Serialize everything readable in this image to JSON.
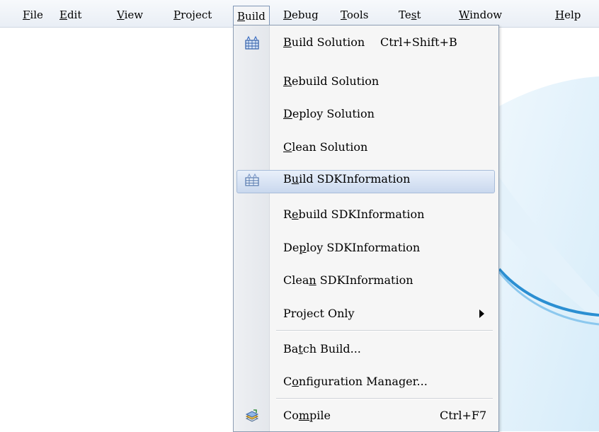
{
  "menubar": {
    "items": [
      {
        "label": "File",
        "hotkey": "F"
      },
      {
        "label": "Edit",
        "hotkey": "E"
      },
      {
        "label": "View",
        "hotkey": "V"
      },
      {
        "label": "Project",
        "hotkey": "P"
      },
      {
        "label": "Build",
        "hotkey": "B"
      },
      {
        "label": "Debug",
        "hotkey": "D"
      },
      {
        "label": "Tools",
        "hotkey": "T"
      },
      {
        "label": "Test",
        "hotkey": "s"
      },
      {
        "label": "Window",
        "hotkey": "W"
      },
      {
        "label": "Help",
        "hotkey": "H"
      }
    ],
    "active": "Build"
  },
  "build_menu": {
    "items": [
      {
        "pre": "",
        "key": "B",
        "post": "uild Solution",
        "shortcut": "Ctrl+Shift+B",
        "icon": "build-solution-icon"
      },
      {
        "pre": "",
        "key": "R",
        "post": "ebuild Solution"
      },
      {
        "pre": "",
        "key": "D",
        "post": "eploy Solution"
      },
      {
        "pre": "",
        "key": "C",
        "post": "lean Solution"
      },
      {
        "pre": "B",
        "key": "u",
        "post": "ild SDKInformation",
        "icon": "build-project-icon",
        "highlighted": true
      },
      {
        "pre": "R",
        "key": "e",
        "post": "build SDKInformation"
      },
      {
        "pre": "De",
        "key": "p",
        "post": "loy SDKInformation"
      },
      {
        "pre": "Clea",
        "key": "n",
        "post": " SDKInformation"
      },
      {
        "pre": "Pro",
        "key": "j",
        "post": "ect Only",
        "submenu": true
      },
      {
        "pre": "Ba",
        "key": "t",
        "post": "ch Build..."
      },
      {
        "pre": "C",
        "key": "o",
        "post": "nfiguration Manager..."
      },
      {
        "pre": "Co",
        "key": "m",
        "post": "pile",
        "shortcut": "Ctrl+F7",
        "icon": "compile-icon"
      }
    ]
  },
  "colors": {
    "highlight_fill": "#c9d8ee",
    "highlight_border": "#a7bcd9",
    "menu_background": "#f6f6f6",
    "accent_swoosh": "#3d9ad6"
  }
}
